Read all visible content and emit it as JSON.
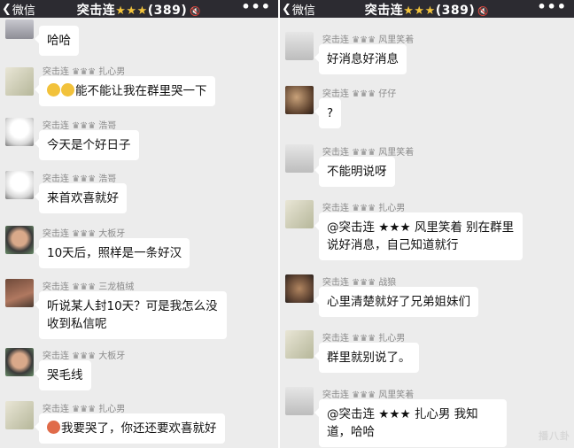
{
  "header": {
    "back_label": "微信",
    "group_name": "突击连",
    "stars": "★★★",
    "member_count": "(389)",
    "more": "•••"
  },
  "left_messages": [
    {
      "name": "",
      "text": "哈哈"
    },
    {
      "name": "突击连 ♛♛♛ 扎心男",
      "text": "能不能让我在群里哭一下"
    },
    {
      "name": "突击连 ♛♛♛ 浩哥",
      "text": "今天是个好日子"
    },
    {
      "name": "突击连 ♛♛♛ 浩哥",
      "text": "来首欢喜就好"
    },
    {
      "name": "突击连 ♛♛♛ 大板牙",
      "text": "10天后，照样是一条好汉"
    },
    {
      "name": "突击连 ♛♛♛ 三龙植绒",
      "text": "听说某人封10天？可是我怎么没收到私信呢"
    },
    {
      "name": "突击连 ♛♛♛ 大板牙",
      "text": "哭毛线"
    },
    {
      "name": "突击连 ♛♛♛ 扎心男",
      "text": "我要哭了，你还还要欢喜就好"
    }
  ],
  "right_messages": [
    {
      "name": "突击连 ♛♛♛ 风里笑着",
      "text": "好消息好消息"
    },
    {
      "name": "突击连 ♛♛♛ 仔仔",
      "text": "?"
    },
    {
      "name": "突击连 ♛♛♛ 风里笑着",
      "text": "不能明说呀"
    },
    {
      "name": "突击连 ♛♛♛ 扎心男",
      "text": "@突击连 ★★★ 风里笑着 别在群里说好消息，自己知道就行"
    },
    {
      "name": "突击连 ♛♛♛ 战狼",
      "text": "心里清楚就好了兄弟姐妹们"
    },
    {
      "name": "突击连 ♛♛♛ 扎心男",
      "text": "群里就别说了。"
    },
    {
      "name": "突击连 ♛♛♛ 风里笑着",
      "text": "@突击连 ★★★ 扎心男 我知道，哈哈"
    }
  ],
  "watermark": "播八卦"
}
